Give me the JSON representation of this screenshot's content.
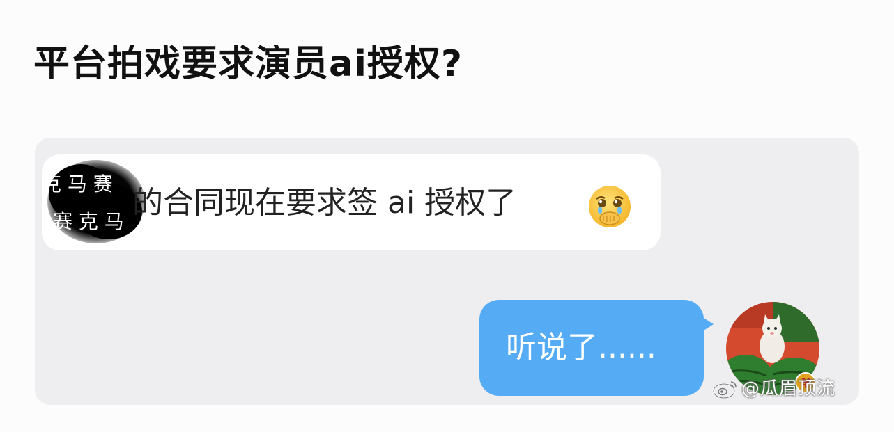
{
  "post": {
    "title": "平台拍戏要求演员ai授权?"
  },
  "chat": {
    "incoming": {
      "redaction_overlay_text": [
        "克 马 赛",
        "赛 克 马"
      ],
      "text": "的合同现在要求签 ai 授权了",
      "emoji": "crying-face-covering-mouth"
    },
    "outgoing": {
      "text": "听说了......",
      "avatar": "watermelon-cat-avatar",
      "avatar_badge": "¥"
    }
  },
  "watermark": {
    "logo": "weibo-logo",
    "text": "@瓜眉顶流"
  },
  "colors": {
    "chat_background": "#eeeef0",
    "incoming_bubble": "#ffffff",
    "outgoing_bubble": "#56acf4",
    "title_text": "#111111"
  }
}
